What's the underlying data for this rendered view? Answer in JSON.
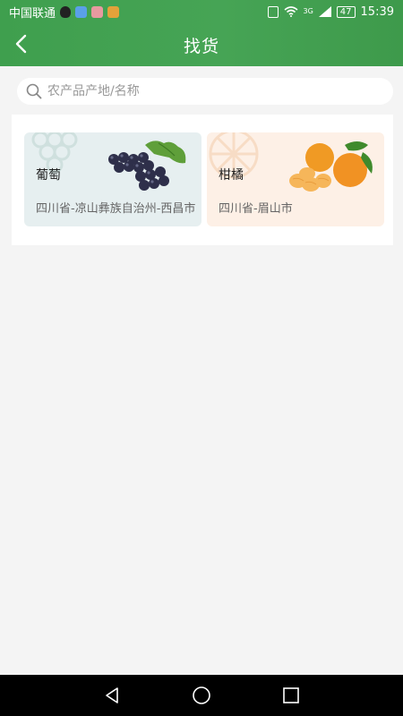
{
  "status_bar": {
    "carrier": "中国联通",
    "signal_label": "3G",
    "battery": "47",
    "time": "15:39"
  },
  "nav": {
    "title": "找货"
  },
  "search": {
    "placeholder": "农产品产地/名称",
    "value": ""
  },
  "products": [
    {
      "name": "葡萄",
      "origin": "四川省-凉山彝族自治州-西昌市"
    },
    {
      "name": "柑橘",
      "origin": "四川省-眉山市"
    }
  ],
  "colors": {
    "header": "#46a455",
    "page_bg": "#f4f4f4",
    "grape_card": "#e6eff0",
    "orange_card": "#fdf0e6"
  },
  "system_nav": {
    "icons": [
      "back-triangle-icon",
      "home-circle-icon",
      "recents-square-icon"
    ]
  }
}
